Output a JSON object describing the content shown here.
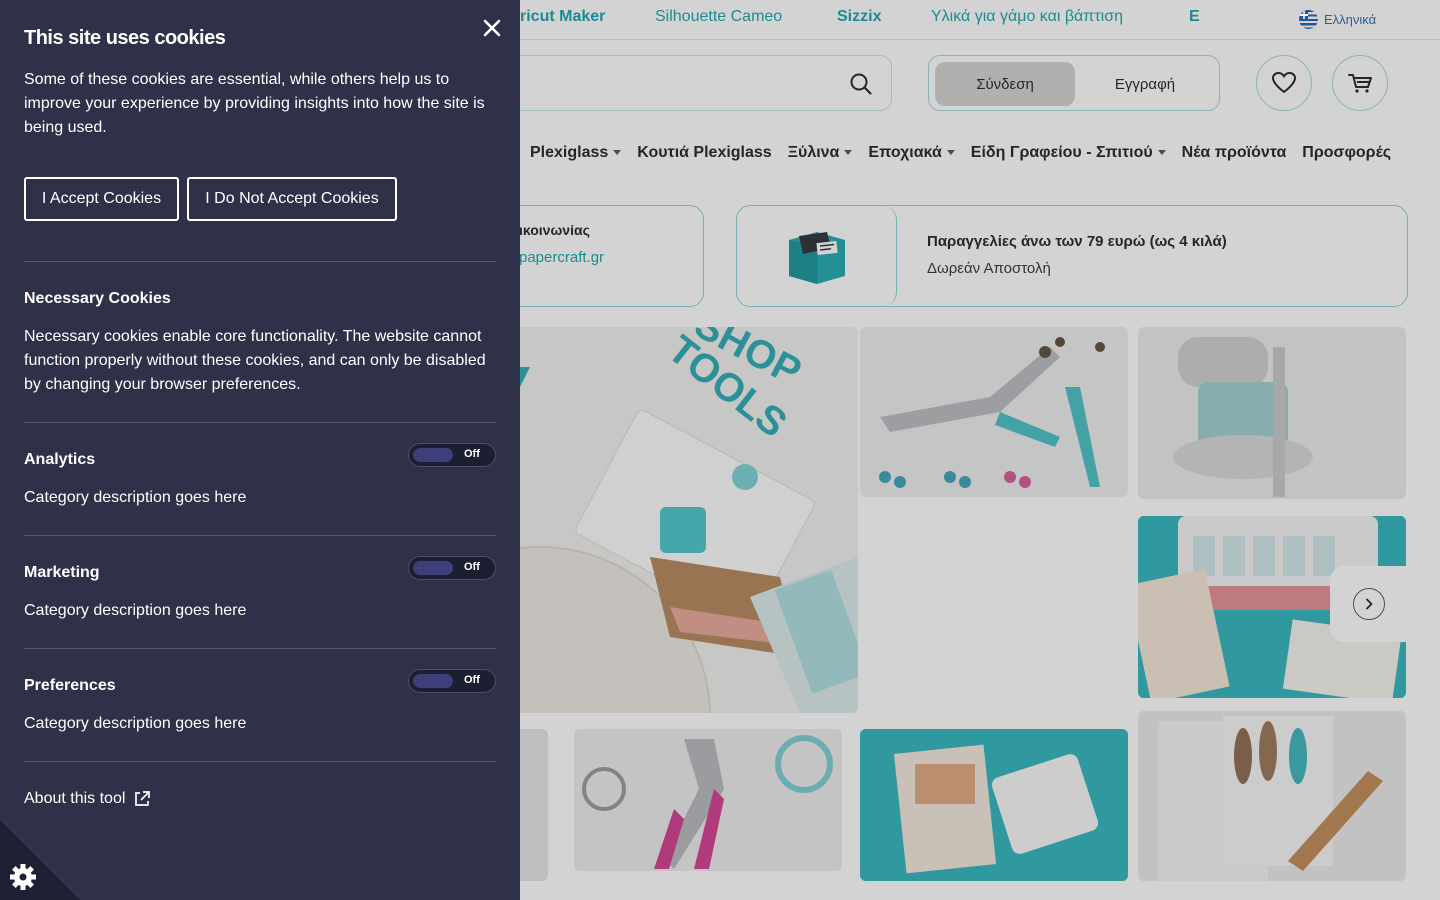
{
  "site": {
    "topbar_brands": [
      "ricut Maker",
      "Silhouette Cameo",
      "Sizzix",
      "Υλικά για γάμο και βάπτιση",
      "E"
    ],
    "language": "Ελληνικά",
    "login_label": "Σύνδεση",
    "register_label": "Εγγραφή",
    "categories": [
      "Plexiglass",
      "Κουτιά Plexiglass",
      "Ξύλινα",
      "Εποχιακά",
      "Είδη Γραφείου - Σπιτιού",
      "Νέα προϊόντα",
      "Προσφορές"
    ],
    "info_left": {
      "title": "ικοινωνίας",
      "link": "papercraft.gr"
    },
    "info_right": {
      "title": "Παραγγελίες άνω των 79 ευρώ (ως 4 κιλά)",
      "subtitle": "Δωρεάν Αποστολή"
    },
    "banner_text_shop": "SHOP",
    "banner_text_tools": "TOOLS",
    "accent_color": "#16a3a9"
  },
  "cookie_panel": {
    "title": "This site uses cookies",
    "intro": "Some of these cookies are essential, while others help us to improve your experience by providing insights into how the site is being used.",
    "accept_label": "I Accept Cookies",
    "reject_label": "I Do Not Accept Cookies",
    "necessary": {
      "title": "Necessary Cookies",
      "text": "Necessary cookies enable core functionality. The website cannot function properly without these cookies, and can only be disabled by changing your browser preferences."
    },
    "categories": [
      {
        "title": "Analytics",
        "text": "Category description goes here",
        "toggle": "Off"
      },
      {
        "title": "Marketing",
        "text": "Category description goes here",
        "toggle": "Off"
      },
      {
        "title": "Preferences",
        "text": "Category description goes here",
        "toggle": "Off"
      }
    ],
    "about_label": "About this tool",
    "background_color": "#2f3148"
  }
}
